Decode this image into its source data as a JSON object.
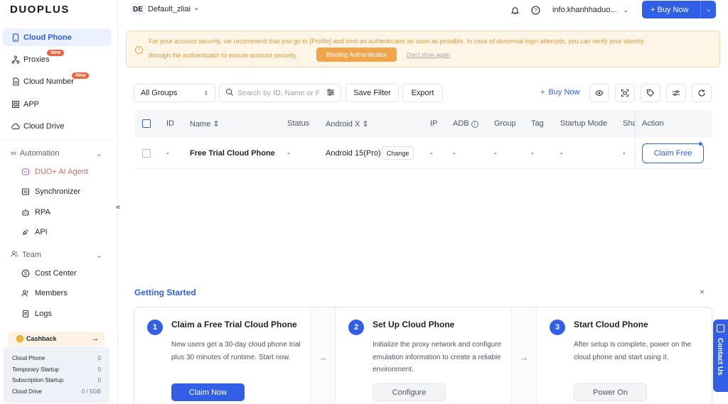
{
  "app": {
    "logo": "DUOPLUS"
  },
  "sidebar": {
    "items": [
      {
        "label": "Cloud Phone",
        "icon": "phone-icon",
        "active": true
      },
      {
        "label": "Proxies",
        "icon": "network-icon",
        "badge": "New"
      },
      {
        "label": "Cloud Number",
        "icon": "sim-card-icon",
        "badge": "New"
      },
      {
        "label": "APP",
        "icon": "grid-icon"
      },
      {
        "label": "Cloud Drive",
        "icon": "cloud-icon"
      }
    ],
    "automation": {
      "label": "Automation",
      "items": [
        {
          "label": "DUO+ AI Agent",
          "icon": "ai-agent-icon"
        },
        {
          "label": "Synchronizer",
          "icon": "sync-icon"
        },
        {
          "label": "RPA",
          "icon": "robot-icon"
        },
        {
          "label": "API",
          "icon": "plug-icon"
        }
      ]
    },
    "team": {
      "label": "Team",
      "items": [
        {
          "label": "Cost Center",
          "icon": "dollar-icon"
        },
        {
          "label": "Members",
          "icon": "members-icon"
        },
        {
          "label": "Logs",
          "icon": "logs-icon"
        }
      ]
    },
    "cashback": {
      "label": "Cashback",
      "arrow": "→"
    },
    "usage": [
      {
        "label": "Cloud Phone",
        "value": "0"
      },
      {
        "label": "Temporary Startup",
        "value": "0"
      },
      {
        "label": "Subscription Startup",
        "value": "0"
      },
      {
        "label": "Cloud Drive",
        "value": "0 / 5GB"
      }
    ],
    "collapse_glyph": "«"
  },
  "topbar": {
    "workspace_badge": "DE",
    "workspace_name": "Default_zliai",
    "account": "info.khanhhaduo...",
    "buy_now": "+ Buy Now"
  },
  "notice": {
    "line1": "For your account security, we recommend that you go to [Profile] and bind an authenticator as soon as possible. In case of abnormal login attempts, you can verify your identity",
    "line2": "through the authenticator to ensure account security.",
    "bind_button": "Binding Authenticator",
    "dont_show": "Don't show again",
    "color": "#e09a3d"
  },
  "toolbar": {
    "group_select": "All Groups",
    "search_placeholder": "Search by ID, Name or P",
    "save_filter": "Save Filter",
    "export": "Export",
    "buy_now": "Buy Now"
  },
  "table": {
    "headers": [
      "ID",
      "Name",
      "Status",
      "Android X",
      "IP",
      "ADB",
      "Group",
      "Tag",
      "Startup Mode",
      "Sha",
      "Action"
    ],
    "rows": [
      {
        "id": "-",
        "name": "Free Trial Cloud Phone",
        "status": "-",
        "android": "Android 15(Pro)",
        "change": "Change",
        "ip": "-",
        "adb": "-",
        "group": "-",
        "tag": "-",
        "startup": "-",
        "share": "-",
        "action": "Claim Free"
      }
    ]
  },
  "getting_started": {
    "title": "Getting Started",
    "close": "×",
    "steps": [
      {
        "num": "1",
        "title": "Claim a Free Trial Cloud Phone",
        "desc": "New users get a 30-day cloud phone trial plus 30 minutes of runtime. Start now.",
        "button": "Claim Now"
      },
      {
        "num": "2",
        "title": "Set Up Cloud Phone",
        "desc": "Initialize the proxy network and configure emulation information to create a reliable environment.",
        "button": "Configure"
      },
      {
        "num": "3",
        "title": "Start Cloud Phone",
        "desc": "After setup is complete, power on the cloud phone and start using it.",
        "button": "Power On"
      }
    ]
  },
  "contact": {
    "label": "Contact Us"
  },
  "colors": {
    "accent": "#3160e6",
    "new_badge": "#f0623b",
    "warning": "#f0a54a"
  }
}
